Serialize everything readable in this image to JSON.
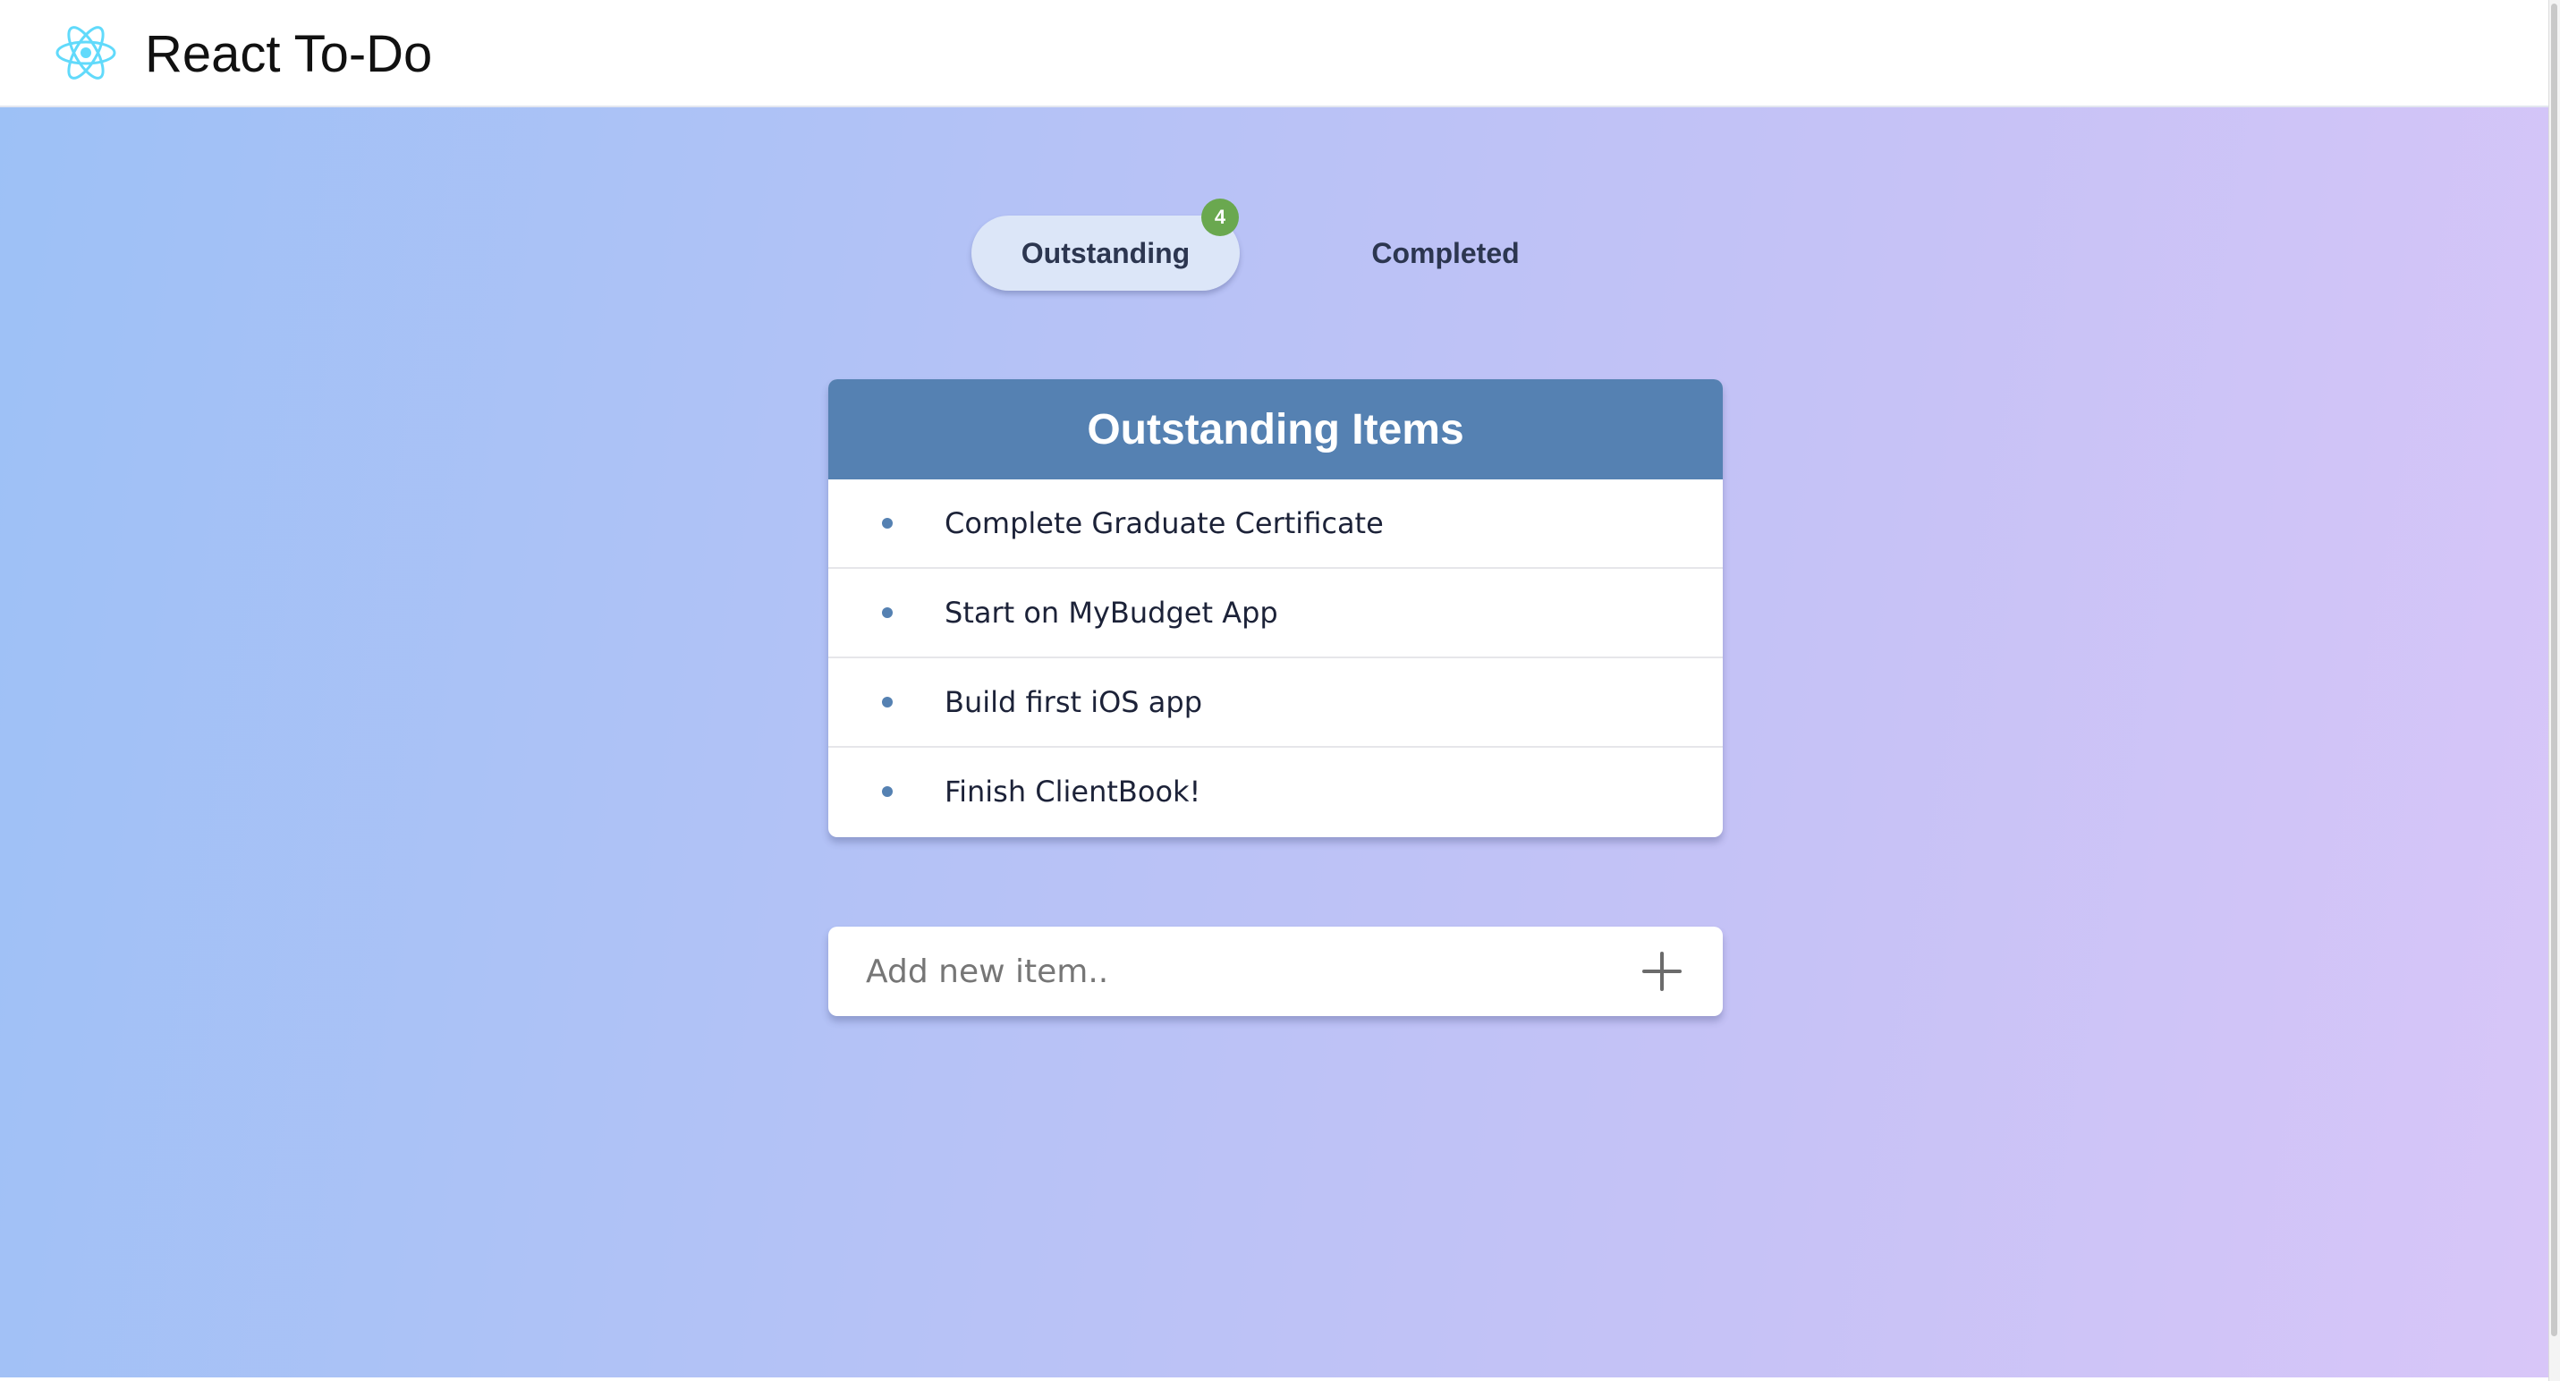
{
  "header": {
    "title": "React To-Do",
    "logo_icon": "react-atom-icon",
    "logo_color": "#61dafb"
  },
  "tabs": [
    {
      "label": "Outstanding",
      "active": true,
      "badge": "4"
    },
    {
      "label": "Completed",
      "active": false
    }
  ],
  "colors": {
    "accent": "#5581b2",
    "badge": "#6aa84f",
    "gradient_start": "#9dc1f6",
    "gradient_end": "#d8c6f8"
  },
  "list": {
    "title": "Outstanding Items",
    "items": [
      "Complete Graduate Certificate",
      "Start on MyBudget App",
      "Build first iOS app",
      "Finish ClientBook!"
    ]
  },
  "add_item": {
    "placeholder": "Add new item..",
    "value": "",
    "button_icon": "plus-icon"
  }
}
